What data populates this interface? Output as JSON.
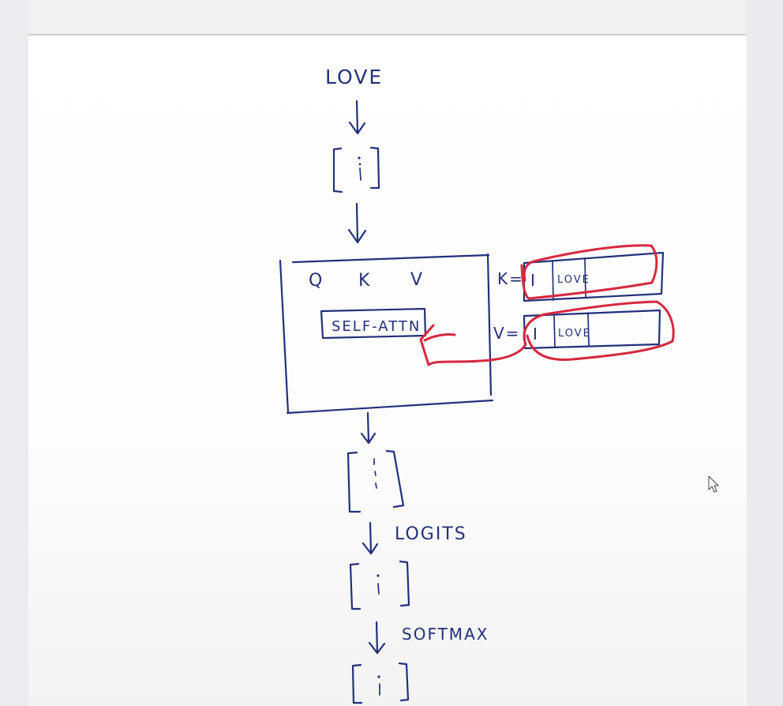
{
  "diagram": {
    "input_token": "LOVE",
    "block": {
      "q_label": "Q",
      "k_label": "K",
      "v_label": "V",
      "attention_label": "SELF-ATTN"
    },
    "cache": {
      "k_label": "K=",
      "v_label": "V=",
      "k_cells": [
        "I",
        "LOVE"
      ],
      "v_cells": [
        "I",
        "LOVE"
      ]
    },
    "logits_label": "LOGITS",
    "softmax_label": "SOFTMAX"
  },
  "colors": {
    "ink": "#23307a",
    "highlight": "#d6293f",
    "paper": "#ffffff"
  },
  "icons": {
    "pointer": "mouse-cursor-icon"
  }
}
